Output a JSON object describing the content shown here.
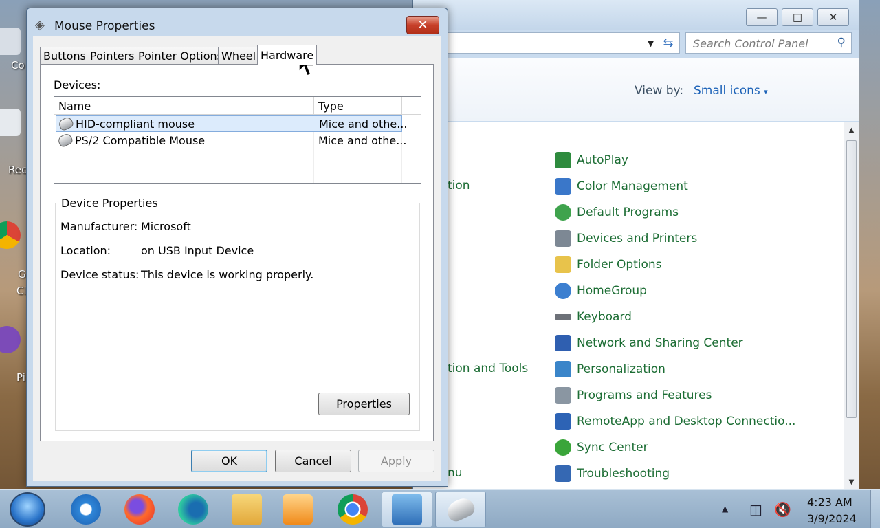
{
  "desktop": {
    "icons": [
      {
        "label": "Co"
      },
      {
        "label": "Rec"
      },
      {
        "label": "G"
      },
      {
        "label": "Cl"
      },
      {
        "label": "Pi"
      }
    ]
  },
  "control_panel": {
    "search_placeholder": "Search Control Panel",
    "view_by_label": "View by:",
    "view_by_value": "Small icons",
    "left_items": [
      "tion",
      "tion and Tools",
      "nu"
    ],
    "items": [
      {
        "label": "AutoPlay",
        "icon": "autoplay-icon",
        "color": "#2e8b3e"
      },
      {
        "label": "Color Management",
        "icon": "color-management-icon",
        "color": "#3a77c9"
      },
      {
        "label": "Default Programs",
        "icon": "default-programs-icon",
        "color": "#3fa34d"
      },
      {
        "label": "Devices and Printers",
        "icon": "printer-icon",
        "color": "#7d8894"
      },
      {
        "label": "Folder Options",
        "icon": "folder-icon",
        "color": "#e8c34b"
      },
      {
        "label": "HomeGroup",
        "icon": "homegroup-icon",
        "color": "#3c7fd0"
      },
      {
        "label": "Keyboard",
        "icon": "keyboard-icon",
        "color": "#6d7178"
      },
      {
        "label": "Network and Sharing Center",
        "icon": "network-icon",
        "color": "#2f5fb0"
      },
      {
        "label": "Personalization",
        "icon": "personalization-icon",
        "color": "#3a85c9"
      },
      {
        "label": "Programs and Features",
        "icon": "programs-icon",
        "color": "#8a96a2"
      },
      {
        "label": "RemoteApp and Desktop Connectio...",
        "icon": "remoteapp-icon",
        "color": "#2d63b5"
      },
      {
        "label": "Sync Center",
        "icon": "sync-icon",
        "color": "#3aa53a"
      },
      {
        "label": "Troubleshooting",
        "icon": "troubleshooting-icon",
        "color": "#3568b3"
      }
    ]
  },
  "dialog": {
    "title": "Mouse Properties",
    "tabs": [
      "Buttons",
      "Pointers",
      "Pointer Options",
      "Wheel",
      "Hardware"
    ],
    "active_tab": "Hardware",
    "devices_label": "Devices:",
    "columns": [
      "Name",
      "Type"
    ],
    "devices": [
      {
        "name": "HID-compliant mouse",
        "type": "Mice and othe..."
      },
      {
        "name": "PS/2 Compatible Mouse",
        "type": "Mice and othe..."
      }
    ],
    "device_properties": {
      "title": "Device Properties",
      "rows": [
        {
          "key": "Manufacturer:",
          "value": "Microsoft"
        },
        {
          "key": "Location:",
          "value": "on USB Input Device"
        },
        {
          "key": "Device status:",
          "value": "This device is working properly."
        }
      ]
    },
    "properties_button": "Properties",
    "ok_button": "OK",
    "cancel_button": "Cancel",
    "apply_button": "Apply"
  },
  "taskbar": {
    "time": "4:23 AM",
    "date": "3/9/2024",
    "apps": [
      "internet-explorer-icon",
      "firefox-icon",
      "edge-icon",
      "file-explorer-icon",
      "media-player-icon",
      "chrome-icon",
      "control-panel-icon",
      "mouse-properties-icon"
    ]
  }
}
